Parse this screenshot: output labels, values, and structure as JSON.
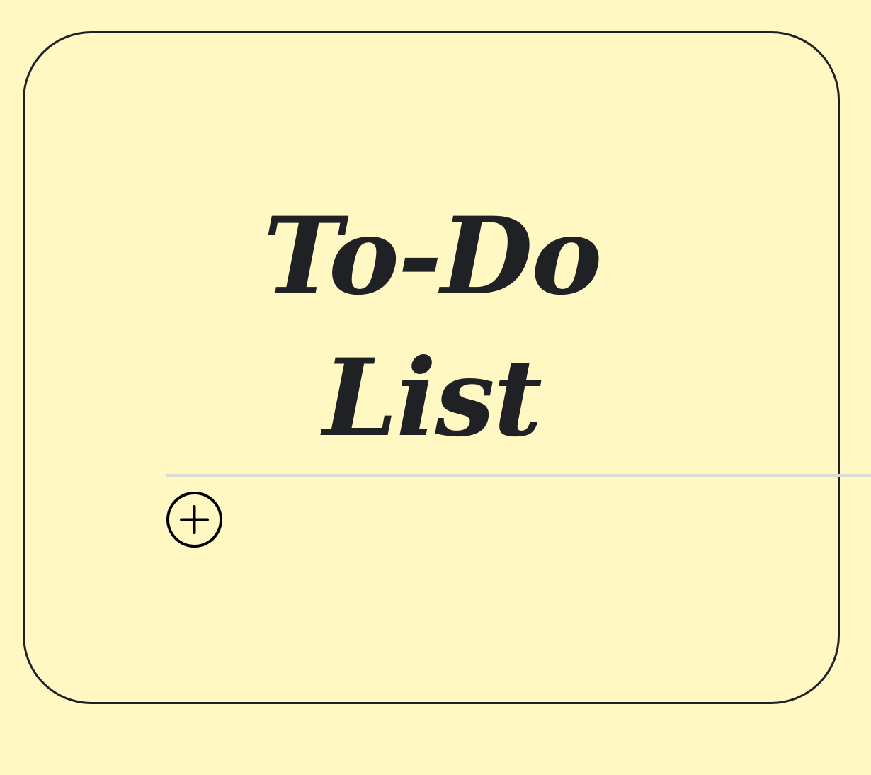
{
  "app": {
    "title": "To-Do List"
  },
  "list": {
    "add_button_icon": "plus-circle-icon"
  },
  "colors": {
    "background": "#fff8c2",
    "ink": "#1f2124",
    "divider": "#dcdbd2"
  }
}
